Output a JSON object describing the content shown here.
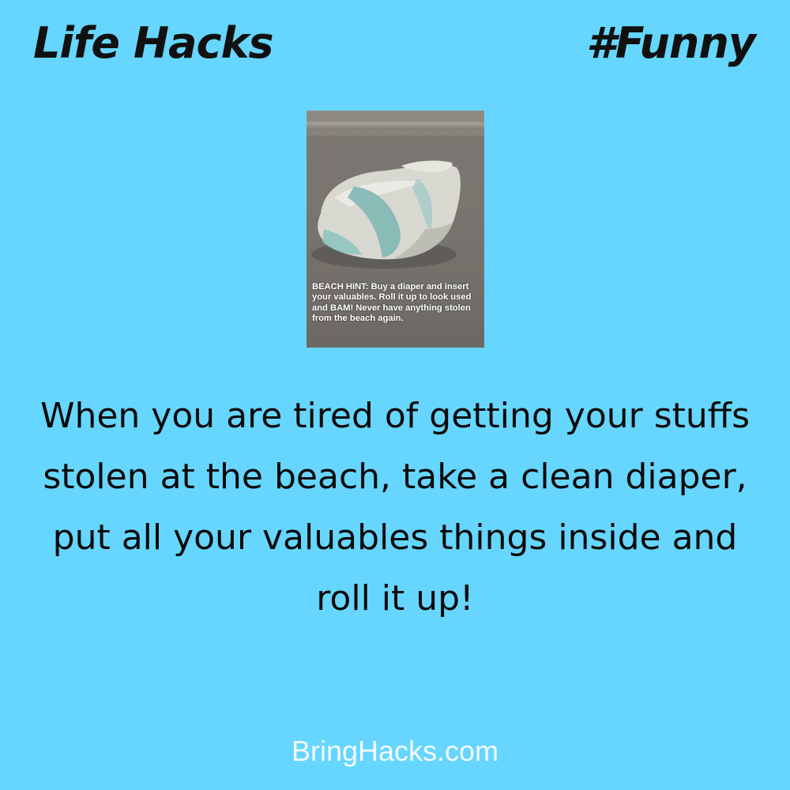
{
  "header": {
    "left_title": "Life Hacks",
    "right_title": "#Funny"
  },
  "photo": {
    "caption": "BEACH HINT: Buy a diaper and insert your valuables. Roll it up to look used and BAM! Never have anything stolen from the beach again."
  },
  "main": {
    "text": "When you are tired of getting your stuffs stolen at the beach, take a clean diaper, put all your valuables things inside and roll it up!"
  },
  "footer": {
    "site": "BringHacks.com"
  },
  "colors": {
    "background": "#66d6fe",
    "title_text": "#111111",
    "body_text": "#0a0a0a",
    "footer_text": "#f3fbff"
  }
}
